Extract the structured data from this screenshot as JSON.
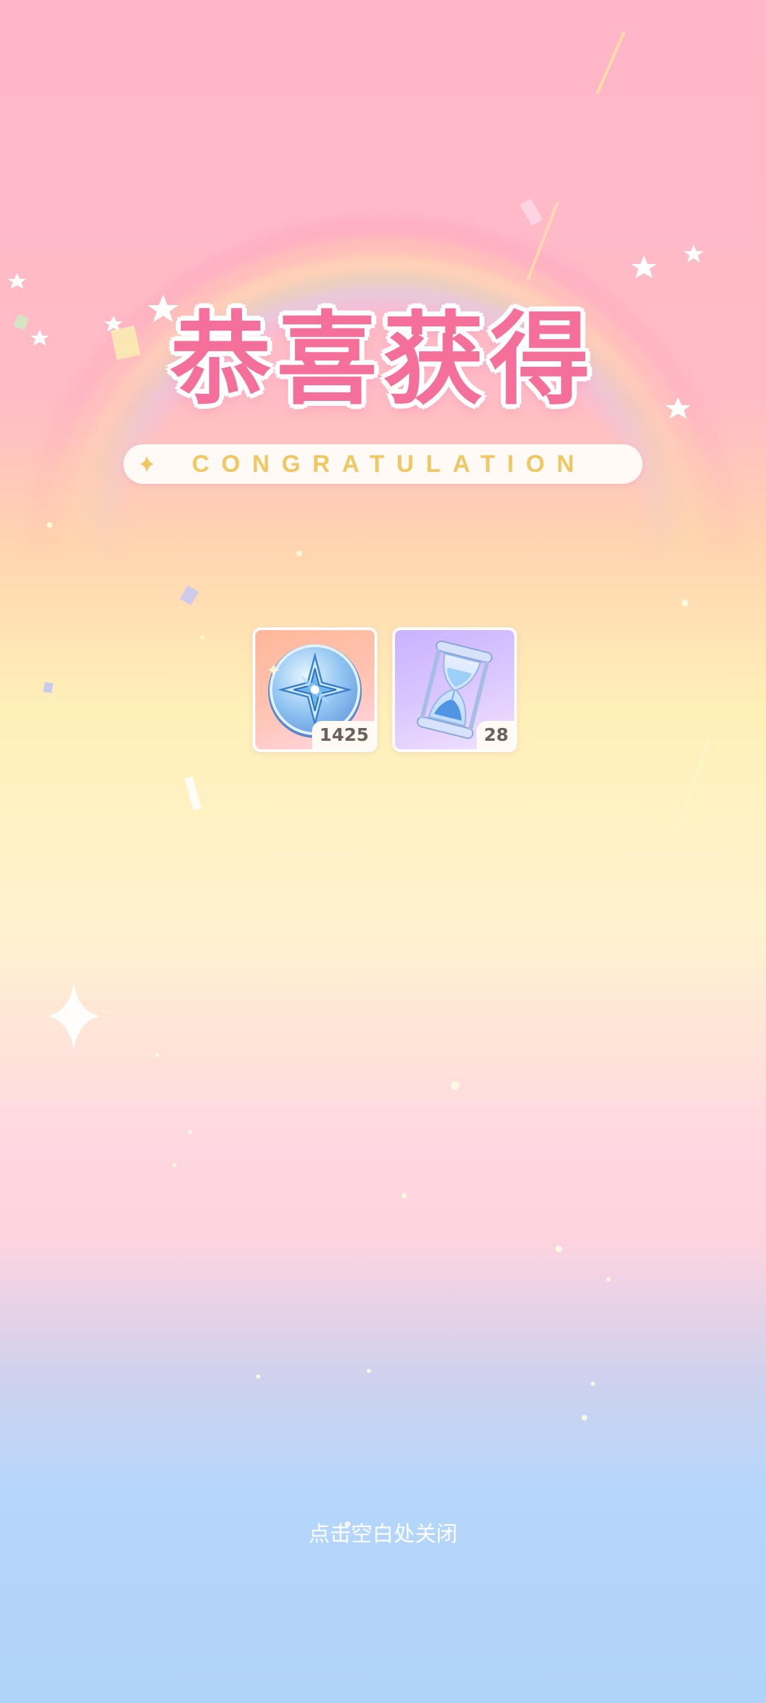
{
  "header": {
    "title": "恭喜获得",
    "subtitle": "CONGRATULATION"
  },
  "rewards": [
    {
      "name": "compass-star-coin",
      "icon": "compass-coin-icon",
      "quantity": "1425"
    },
    {
      "name": "hourglass",
      "icon": "hourglass-icon",
      "quantity": "28"
    }
  ],
  "footer": {
    "close_hint": "点击空白处关闭"
  },
  "colors": {
    "title_pink": "#f56f9b",
    "subtitle_gold": "#f0c760",
    "bg_top": "#ffb6c8",
    "bg_bottom": "#b0d3fa"
  }
}
